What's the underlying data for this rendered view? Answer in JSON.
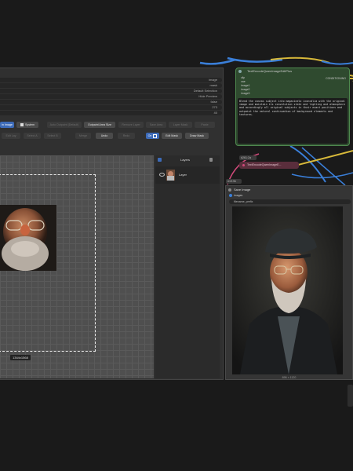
{
  "editor": {
    "props": [
      {
        "label": "image"
      },
      {
        "label": "mask"
      },
      {
        "label": "Default Selection"
      },
      {
        "label": "Hide Preview"
      },
      {
        "label": "false"
      },
      {
        "label": "273"
      },
      {
        "label": "40"
      }
    ],
    "toolbar_row1": {
      "image_btn": "in Image",
      "system_btn": "System",
      "auto_outpaint": "Auto Outpaint (Default)",
      "outpaint_area": "Outpaint Area Size",
      "remove_layer": "Remove Layer",
      "save_area": "Save Area",
      "layer_mask": "Layer Mask",
      "paste": "Paste"
    },
    "toolbar_row2": {
      "t1": "Edit Lay",
      "t2": "Select A",
      "t3": "Select B",
      "t4": "Merge",
      "t5": "Undo",
      "t6": "Redo",
      "on": "On",
      "edit_mask": "Edit Mask",
      "draw_mask": "Draw Mask"
    },
    "canvas_size": "1344x1568",
    "layers_title": "Layers",
    "layer_name": "Layer"
  },
  "text_node": {
    "title": "TextEncodeQwenImageEditPlus",
    "inputs": [
      "clip",
      "vae",
      "image1",
      "image2",
      "image3"
    ],
    "output": "CONDITIONING",
    "prompt": "Blend the canvas subject into magazinelo iconcdlia with the original image and maintain its convolution state and lighting and atmosphere and accordingly all original subjects in their exact positions and outpaint the natural continuation of background elements and textures."
  },
  "small_node": {
    "badge": "#261:2a",
    "title": "TextEncodeQwenImageE..."
  },
  "save_node": {
    "badge": "#19:9b",
    "title": "Save Image",
    "input": "images",
    "filename_prefix": "filename_prefix",
    "caption": "896 × 1120"
  },
  "colors": {
    "wire_blue": "#3a7fd9",
    "wire_yellow": "#d8b93a",
    "wire_pink": "#d14a7a",
    "node_green": "#2f4a2f",
    "accent_blue": "#3d6bb8"
  }
}
